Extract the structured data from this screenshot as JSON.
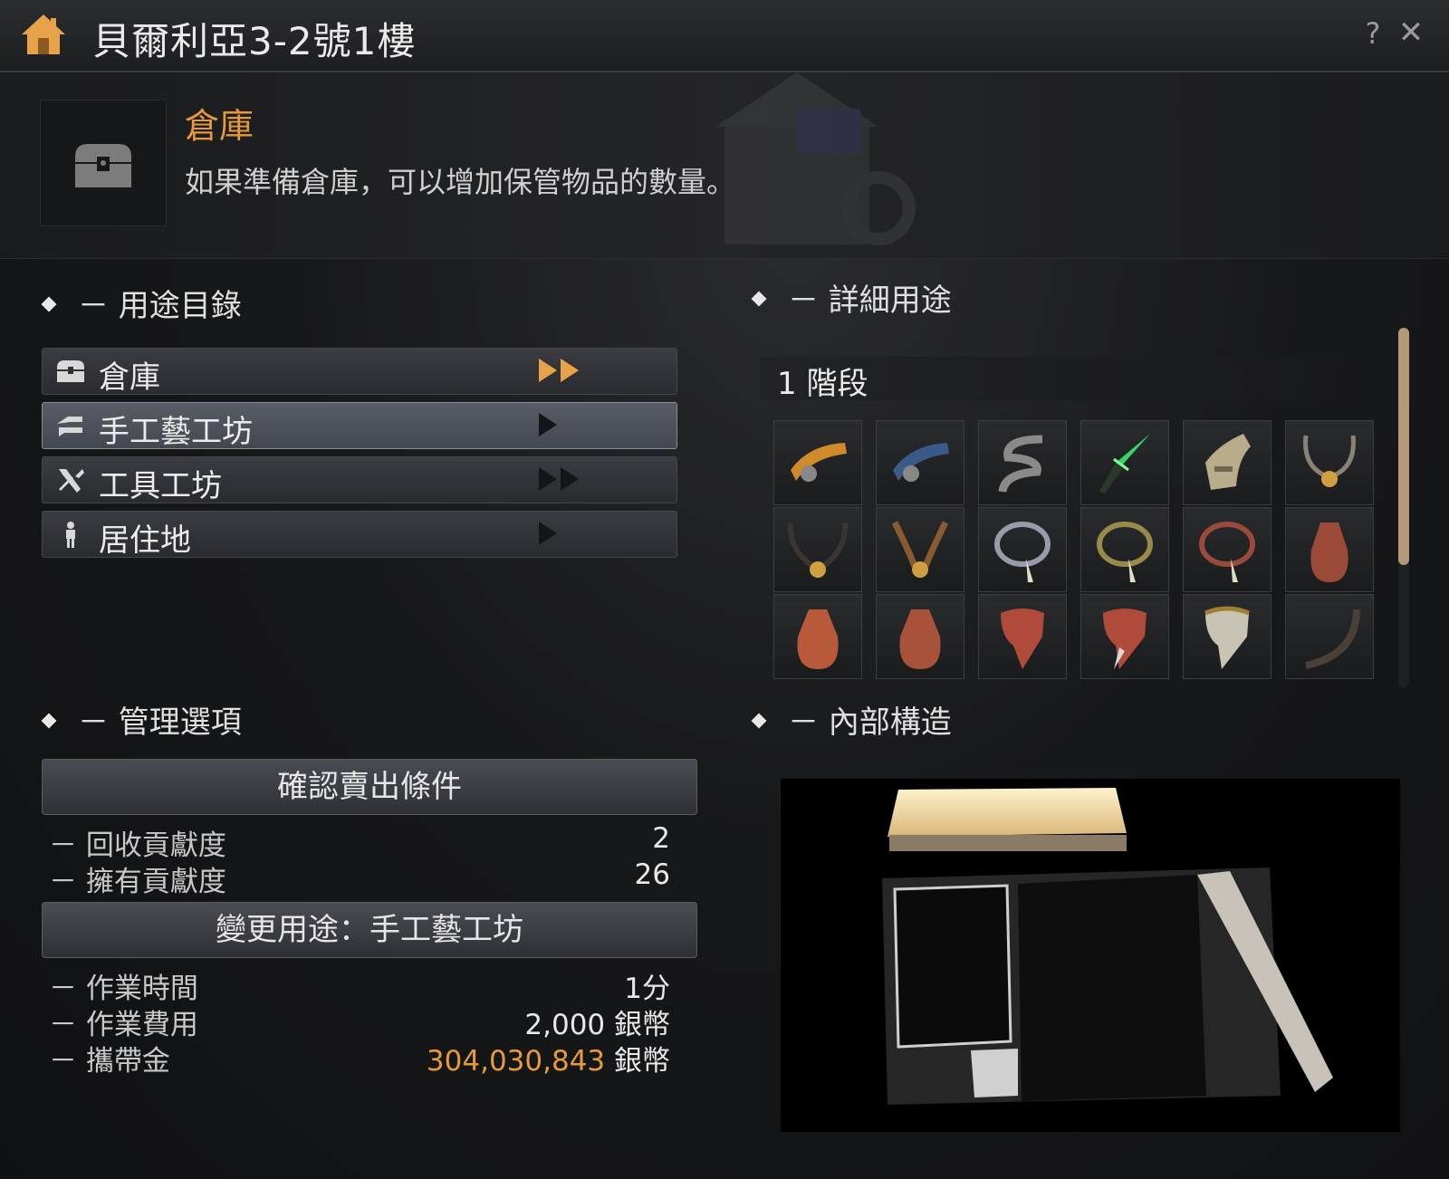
{
  "window": {
    "title": "貝爾利亞3-2號1樓",
    "help_label": "?",
    "close_label": "✕",
    "home_icon": "house-icon"
  },
  "header": {
    "icon": "chest-icon",
    "name": "倉庫",
    "description": "如果準備倉庫，可以增加保管物品的數量。"
  },
  "usage_list": {
    "title": "－ 用途目錄",
    "items": [
      {
        "label": "倉庫",
        "icon": "chest-icon",
        "arrows": "double-gold",
        "selected": false
      },
      {
        "label": "手工藝工坊",
        "icon": "workshop-icon",
        "arrows": "single-dark",
        "selected": true
      },
      {
        "label": "工具工坊",
        "icon": "hammer-icon",
        "arrows": "double-dark",
        "selected": false
      },
      {
        "label": "居住地",
        "icon": "person-icon",
        "arrows": "single-dark",
        "selected": false
      }
    ]
  },
  "details": {
    "title": "－ 詳細用途",
    "stage_label": "1 階段",
    "items": [
      "orange-belt-icon",
      "blue-belt-icon",
      "coiled-horn-icon",
      "green-dagger-icon",
      "gauntlet-icon",
      "horned-amulet-icon",
      "black-horns-icon",
      "brown-horns-icon",
      "necklace-silver-icon",
      "necklace-gold-icon",
      "necklace-red-icon",
      "leather-pouch-icon",
      "leather-pouch-icon",
      "leather-pouch-icon",
      "red-mask-icon",
      "red-mask-icon",
      "silver-mask-icon",
      "horn-icon"
    ]
  },
  "management": {
    "title": "－ 管理選項",
    "confirm_button": "確認賣出條件",
    "recovery_label": "－ 回收貢獻度",
    "recovery_value": "2",
    "owned_label": "－ 擁有貢獻度",
    "owned_value": "26",
    "change_button": "變更用途：手工藝工坊",
    "time_label": "－ 作業時間",
    "time_value": "1分",
    "cost_label": "－ 作業費用",
    "cost_value": "2,000 銀幣",
    "money_label": "－ 攜帶金",
    "money_amount": "304,030,843",
    "money_unit": " 銀幣"
  },
  "interior": {
    "title": "－ 內部構造"
  },
  "colors": {
    "accent_gold": "#e89a3a",
    "selected_row": "#4a4d55"
  }
}
